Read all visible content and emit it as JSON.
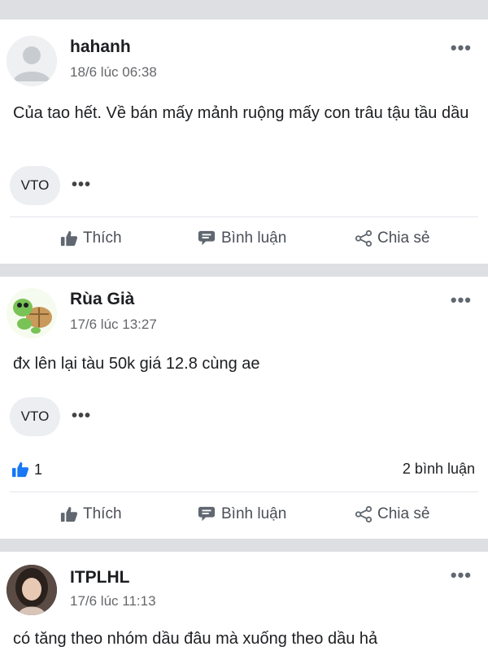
{
  "posts": [
    {
      "author": "hahanh",
      "time": "18/6 lúc 06:38",
      "content": "Của tao hết. Về bán mấy mảnh ruộng mấy con trâu tậu tầu dầu",
      "tag": "VTO",
      "more": "•••",
      "tag_more": "•••",
      "avatar_icon": "default-user-avatar"
    },
    {
      "author": "Rùa Già",
      "time": "17/6 lúc 13:27",
      "content": "đx lên lại tàu 50k giá 12.8 cùng ae",
      "tag": "VTO",
      "more": "•••",
      "tag_more": "•••",
      "likes": "1",
      "comments": "2 bình luận",
      "avatar_icon": "turtle-avatar"
    },
    {
      "author": "ITPLHL",
      "time": "17/6 lúc 11:13",
      "content": "có tăng theo nhóm dầu đâu mà xuống theo dầu hả",
      "more": "•••",
      "avatar_icon": "photo-avatar"
    }
  ],
  "actions": {
    "like": "Thích",
    "comment": "Bình luận",
    "share": "Chia sẻ"
  },
  "colors": {
    "separator": "#dddfe2",
    "like_blue": "#1877f2",
    "text_secondary": "#65676b"
  }
}
